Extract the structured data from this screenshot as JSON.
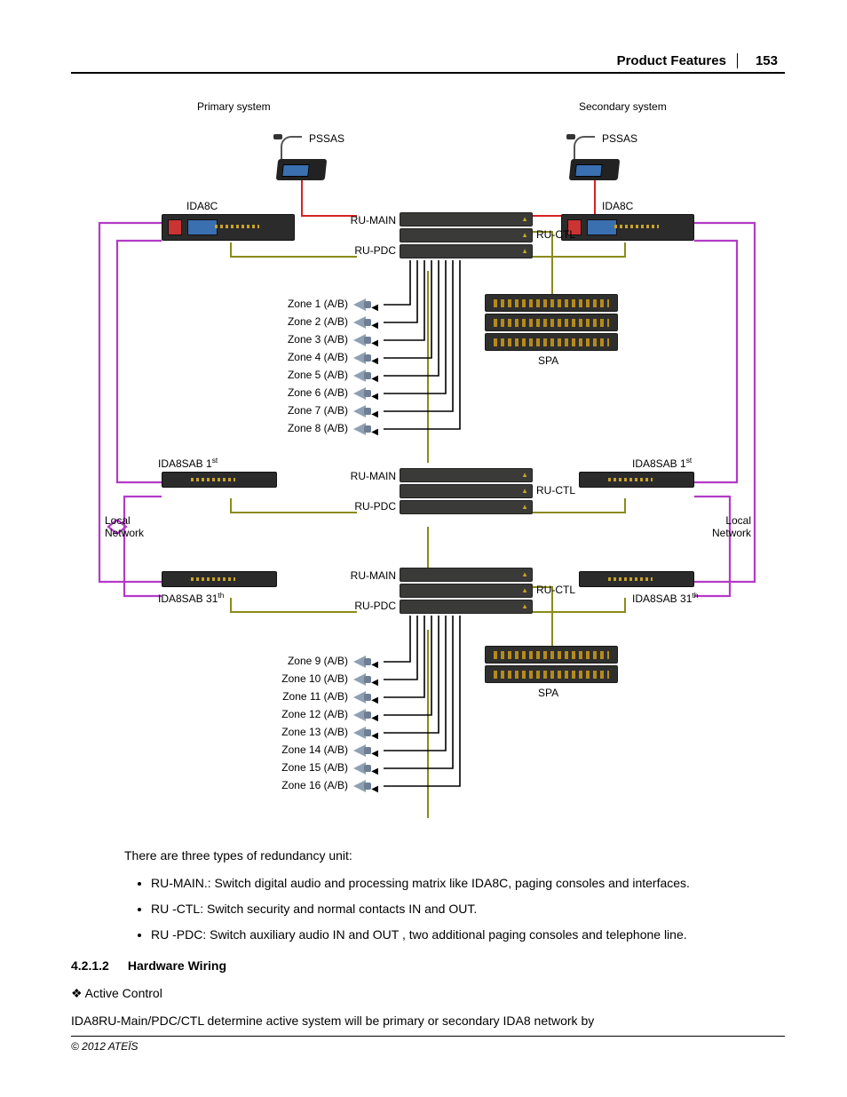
{
  "header": {
    "title": "Product Features",
    "page_number": "153"
  },
  "diagram": {
    "primary_label": "Primary system",
    "secondary_label": "Secondary system",
    "pssas_left": "PSSAS",
    "pssas_right": "PSSAS",
    "ida8c_left": "IDA8C",
    "ida8c_right": "IDA8C",
    "ru_main": "RU-MAIN",
    "ru_pdc": "RU-PDC",
    "ru_ctl": "RU-CTL",
    "spa": "SPA",
    "ida8sab1_left": "IDA8SAB 1",
    "ida8sab1_right": "IDA8SAB 1",
    "ida8sab1_sup": "st",
    "local_network": "Local\nNetwork",
    "ida8sab31_left": "IDA8SAB 31",
    "ida8sab31_right": "IDA8SAB 31",
    "ida8sab31_sup": "th",
    "zones_top": [
      "Zone 1 (A/B)",
      "Zone 2 (A/B)",
      "Zone 3 (A/B)",
      "Zone 4 (A/B)",
      "Zone 5 (A/B)",
      "Zone 6 (A/B)",
      "Zone 7 (A/B)",
      "Zone 8 (A/B)"
    ],
    "zones_bottom": [
      "Zone 9 (A/B)",
      "Zone 10 (A/B)",
      "Zone 11 (A/B)",
      "Zone 12 (A/B)",
      "Zone 13 (A/B)",
      "Zone 14 (A/B)",
      "Zone 15 (A/B)",
      "Zone 16 (A/B)"
    ]
  },
  "body": {
    "intro": "There are three types of redundancy unit:",
    "bullets": [
      "RU-MAIN.: Switch digital audio and processing matrix like IDA8C, paging consoles and interfaces.",
      "RU -CTL: Switch security and normal contacts IN and OUT.",
      "RU -PDC: Switch auxiliary audio IN and OUT , two additional paging consoles and telephone line."
    ],
    "section_num": "4.2.1.2",
    "section_title": "Hardware Wiring",
    "diamond_label": "Active Control",
    "paragraph": "IDA8RU-Main/PDC/CTL determine active system will be primary or secondary IDA8 network by"
  },
  "footer": {
    "copyright": "© 2012 ATEÏS"
  }
}
